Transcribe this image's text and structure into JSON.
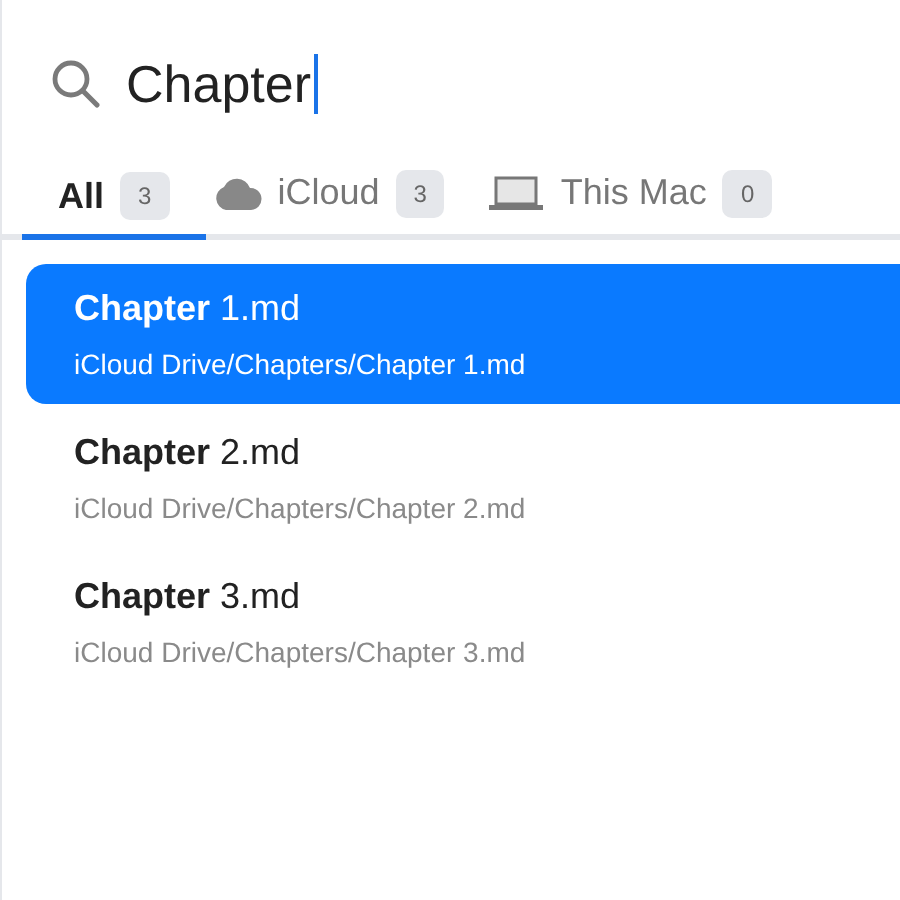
{
  "search": {
    "value": "Chapter"
  },
  "tabs": [
    {
      "kind": "all",
      "label": "All",
      "count": "3",
      "selected": true
    },
    {
      "kind": "cloud",
      "label": "iCloud",
      "count": "3",
      "selected": false
    },
    {
      "kind": "computer",
      "label": "This Mac",
      "count": "0",
      "selected": false
    }
  ],
  "results": [
    {
      "name": "**Chapter** 1.md",
      "path": "iCloud Drive/Chapters/Chapter 1.md",
      "selected": true
    },
    {
      "name": "**Chapter** 2.md",
      "path": "iCloud Drive/Chapters/Chapter 2.md",
      "selected": false
    },
    {
      "name": "**Chapter** 3.md",
      "path": "iCloud Drive/Chapters/Chapter 3.md",
      "selected": false
    }
  ]
}
